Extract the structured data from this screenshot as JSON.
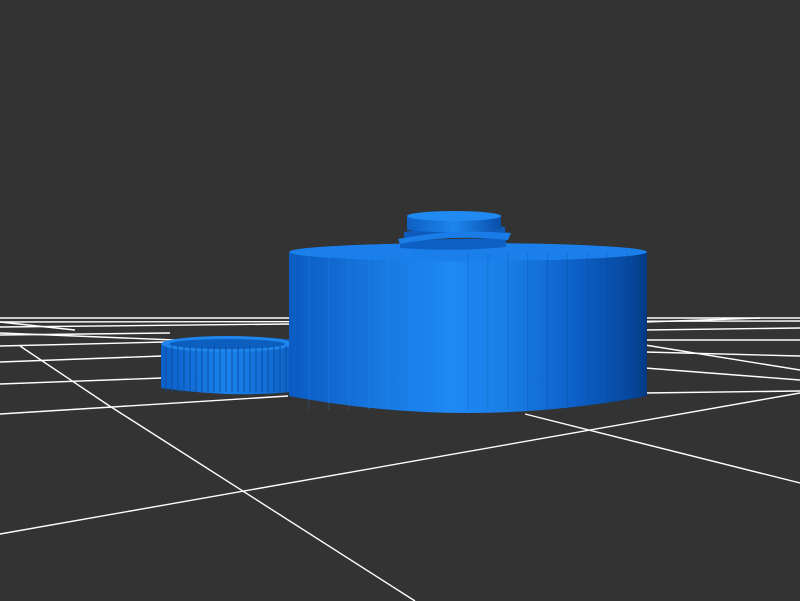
{
  "scene": {
    "background_color": "#333333",
    "grid_color": "#ffffff",
    "model_color": "#1f7fe6",
    "objects": [
      "ground-grid",
      "large-cylinder",
      "threaded-top-knob",
      "spur-gear"
    ]
  }
}
